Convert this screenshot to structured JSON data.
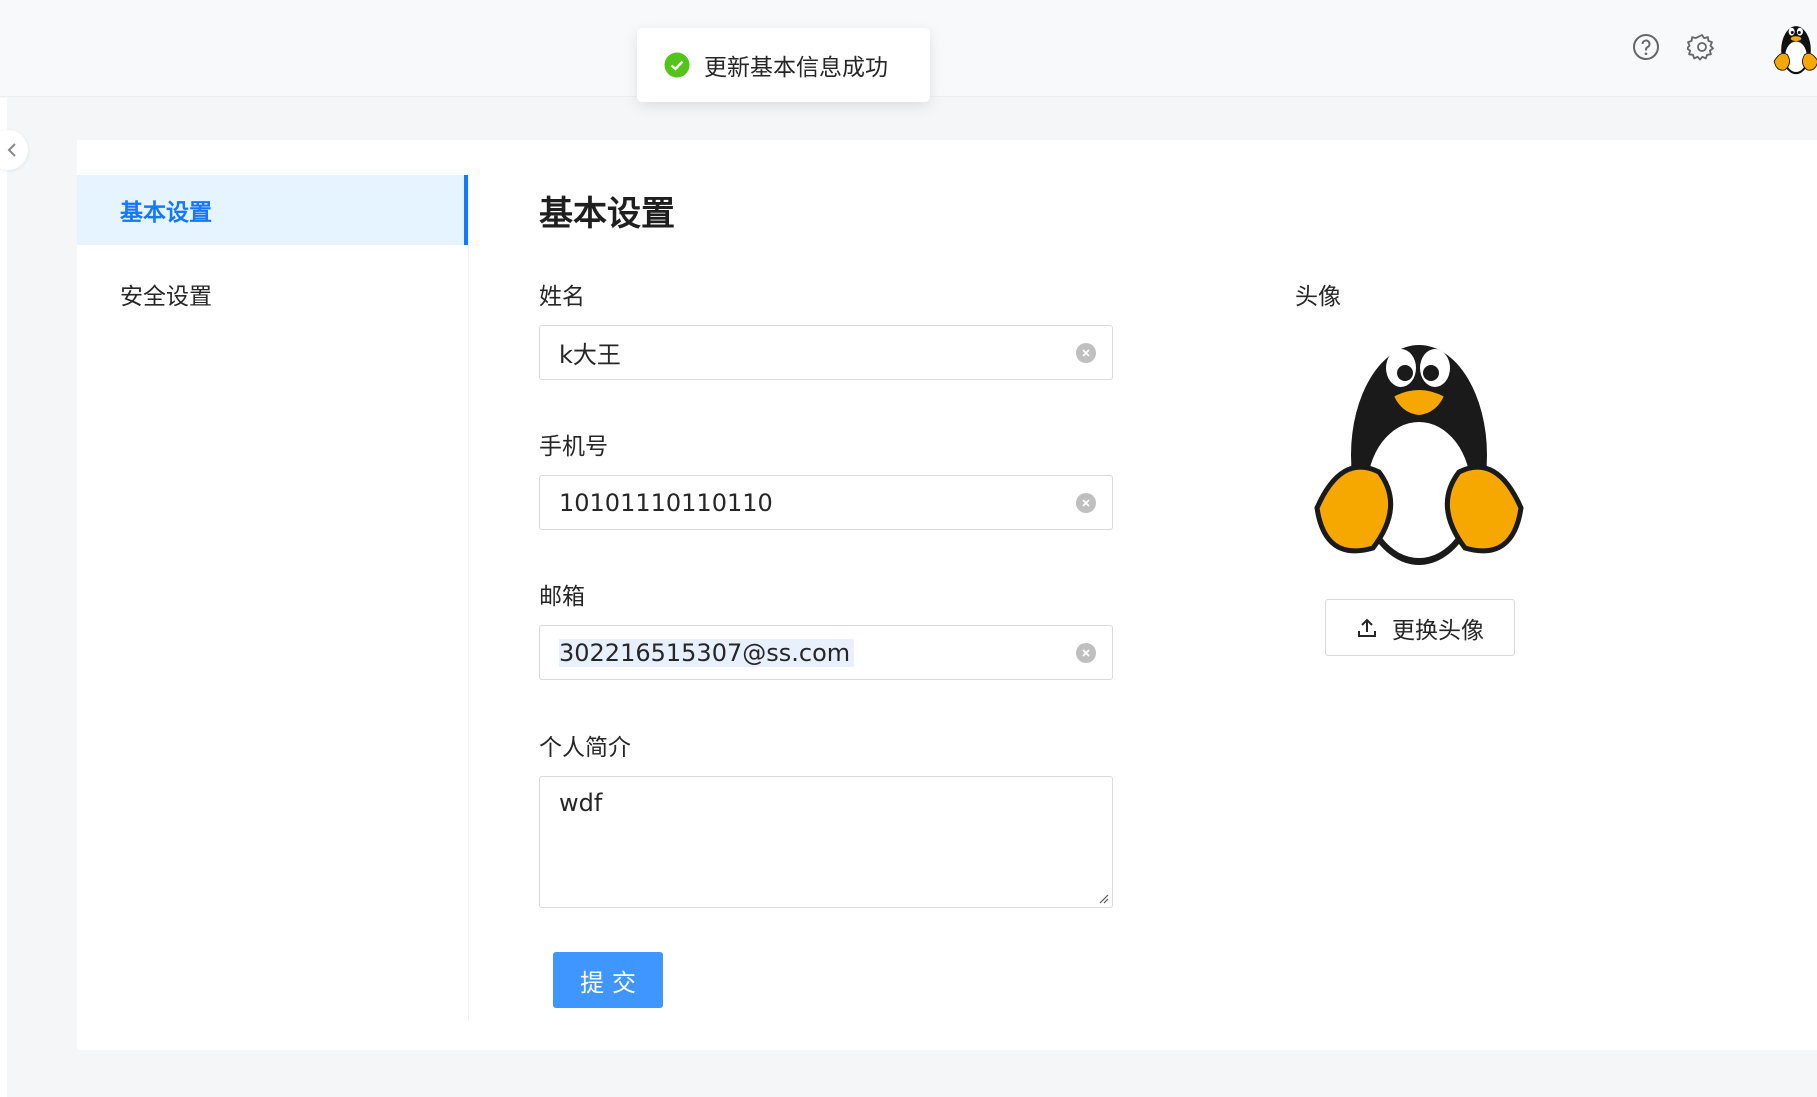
{
  "toast": {
    "message": "更新基本信息成功",
    "icon": "check-circle-icon",
    "color": "#52c41a"
  },
  "header": {
    "help_icon": "question-circle-icon",
    "settings_icon": "gear-icon",
    "avatar_icon": "penguin-avatar-icon"
  },
  "menu": {
    "items": [
      {
        "label": "基本设置",
        "active": true
      },
      {
        "label": "安全设置",
        "active": false
      }
    ]
  },
  "form": {
    "title": "基本设置",
    "name": {
      "label": "姓名",
      "value": "k大王"
    },
    "phone": {
      "label": "手机号",
      "value": "10101110110110"
    },
    "email": {
      "label": "邮箱",
      "value": "302216515307@ss.com"
    },
    "bio": {
      "label": "个人简介",
      "value": "wdf"
    },
    "submit_label": "提交"
  },
  "avatar": {
    "label": "头像",
    "upload_label": "更换头像",
    "icon": "upload-icon"
  },
  "colors": {
    "primary": "#1677ff",
    "button": "#4096ff",
    "active_bg": "#e6f4ff",
    "success": "#52c41a"
  }
}
